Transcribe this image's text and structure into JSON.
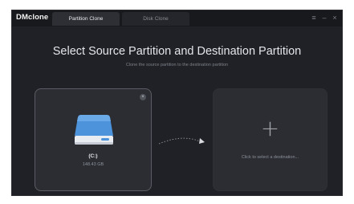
{
  "app": {
    "brand": "DMclone"
  },
  "tabs": [
    {
      "label": "Partition Clone",
      "active": true
    },
    {
      "label": "Disk Clone",
      "active": false
    }
  ],
  "window_controls": {
    "menu": "≡",
    "minimize": "–",
    "close": "×"
  },
  "header": {
    "title": "Select Source Partition and Destination Partition",
    "subtitle": "Clone the source partition to the destination partition"
  },
  "source": {
    "drive_label": "(C:)",
    "size": "148.43 GB",
    "close_symbol": "×"
  },
  "destination": {
    "plus_symbol": "+",
    "prompt": "Click to select a destination..."
  },
  "colors": {
    "background": "#202126",
    "titlebar": "#18191d",
    "card": "#2b2d33",
    "drive_blue": "#4a8fd6"
  }
}
